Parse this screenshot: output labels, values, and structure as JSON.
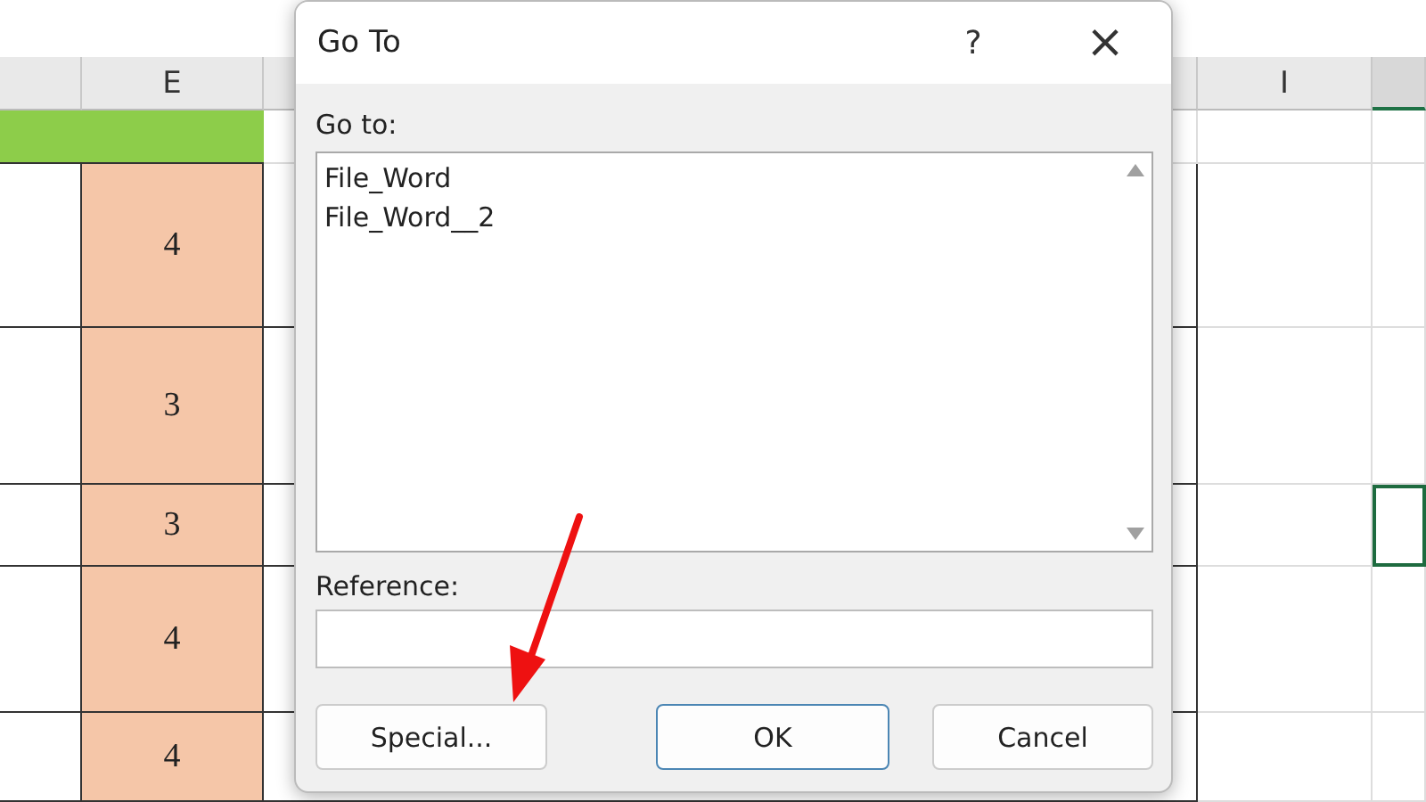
{
  "sheet": {
    "column_headers": [
      "E",
      "I"
    ],
    "rows": [
      {
        "column_e": "4",
        "selected": false
      },
      {
        "column_e": "3",
        "selected": false
      },
      {
        "column_e": "3",
        "selected": true
      },
      {
        "column_e": "4",
        "selected": false
      },
      {
        "column_e": "4",
        "selected": false
      }
    ]
  },
  "dialog": {
    "title": "Go To",
    "help": "?",
    "close": "×",
    "list_label": "Go to:",
    "list_items": [
      "File_Word",
      "File_Word__2"
    ],
    "reference_label": "Reference:",
    "buttons": [
      {
        "label": "Special...",
        "kind": "normal"
      },
      {
        "label": "OK",
        "kind": "default"
      },
      {
        "label": "Cancel",
        "kind": "normal"
      }
    ]
  }
}
